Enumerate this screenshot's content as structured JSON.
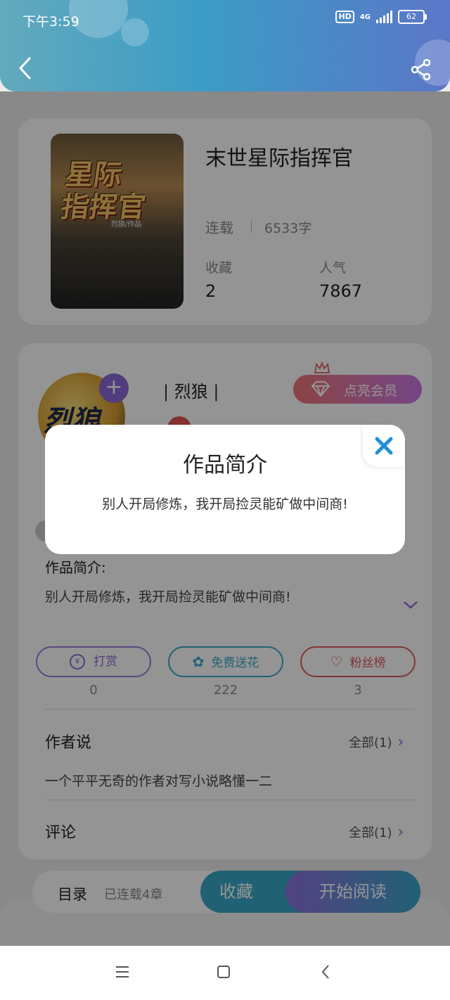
{
  "status": {
    "time": "下午3:59",
    "network": "4G",
    "hd": "HD",
    "battery": "62"
  },
  "book": {
    "title": "末世星际指挥官",
    "status": "连载",
    "word_count": "6533字",
    "favorites_label": "收藏",
    "favorites_value": "2",
    "popularity_label": "人气",
    "popularity_value": "7867",
    "cover_text_line1": "星际",
    "cover_text_line2": "指挥官",
    "cover_author": "烈狼/作品"
  },
  "author": {
    "name": "烈狼",
    "avatar_text": "烈狼",
    "vip_button": "点亮会员"
  },
  "intro": {
    "label": "作品简介:",
    "text": "别人开局修炼，我开局捡灵能矿做中间商!"
  },
  "actions": [
    {
      "label": "打赏",
      "count": "0"
    },
    {
      "label": "免费送花",
      "count": "222"
    },
    {
      "label": "粉丝榜",
      "count": "3"
    }
  ],
  "author_says": {
    "title": "作者说",
    "all": "全部(1)",
    "text": "一个平平无奇的作者对写小说略懂一二"
  },
  "comments": {
    "title": "评论",
    "all": "全部(1)"
  },
  "bottom_bar": {
    "toc": "目录",
    "toc_status": "已连载4章",
    "collect": "收藏",
    "read": "开始阅读"
  },
  "modal": {
    "title": "作品简介",
    "text": "别人开局修炼，我开局捡灵能矿做中间商!"
  },
  "colors": {
    "accent_teal": "#3aa8c9",
    "accent_purple": "#7e6ad8",
    "red": "#e05a5a"
  }
}
